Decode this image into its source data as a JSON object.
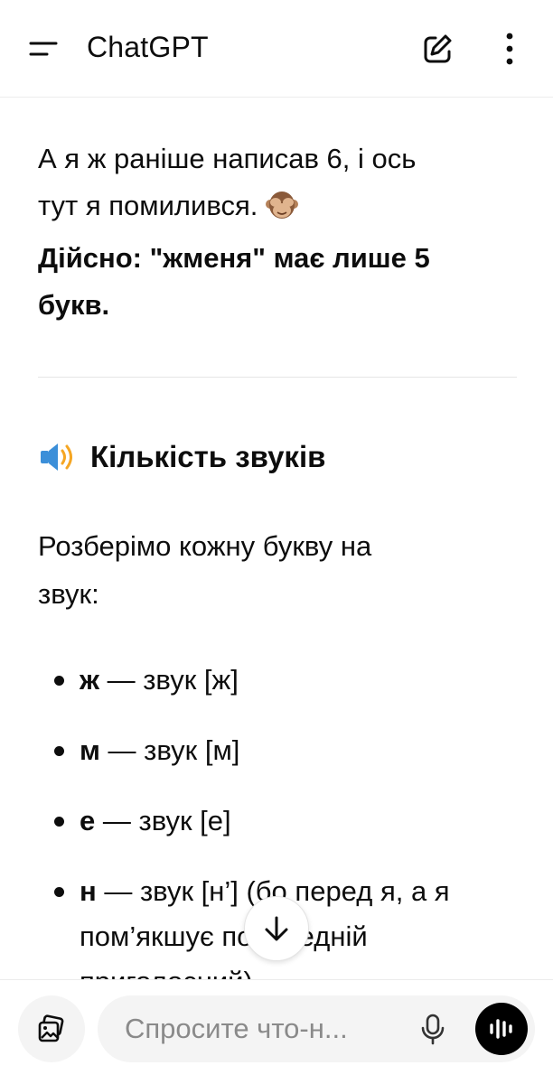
{
  "header": {
    "title": "ChatGPT",
    "menu_icon": "menu-icon",
    "new_chat_icon": "edit-icon",
    "more_icon": "more-vertical-icon"
  },
  "message": {
    "para1_line1": "А я ж раніше написав 6, і ось",
    "para1_line2": "тут я помилився.",
    "para1_line3": "Дійсно: \"жменя\" має лише 5",
    "para1_line4": "букв.",
    "section_heading": "Кількість звуків",
    "section_icon": "speaker-icon",
    "intro_line1": "Розберімо кожну букву на",
    "intro_line2": "звук:",
    "bullets": [
      {
        "letter": "ж",
        "text": " — звук [ж]"
      },
      {
        "letter": "м",
        "text": " — звук [м]"
      },
      {
        "letter": "е",
        "text": " — звук [е]"
      },
      {
        "letter": "н",
        "text": " — звук [н’] (бо перед я, а я",
        "line2": "пом’якшує попередній",
        "line3": "приголосний)"
      }
    ]
  },
  "composer": {
    "placeholder": "Спросите что-н...",
    "attach_icon": "image-attach-icon",
    "mic_icon": "microphone-icon",
    "voice_icon": "voice-waveform-icon"
  },
  "scroll_down_icon": "arrow-down-icon",
  "colors": {
    "text": "#0d0d0d",
    "pill_bg": "#f4f4f4",
    "voice_button_bg": "#000000"
  }
}
